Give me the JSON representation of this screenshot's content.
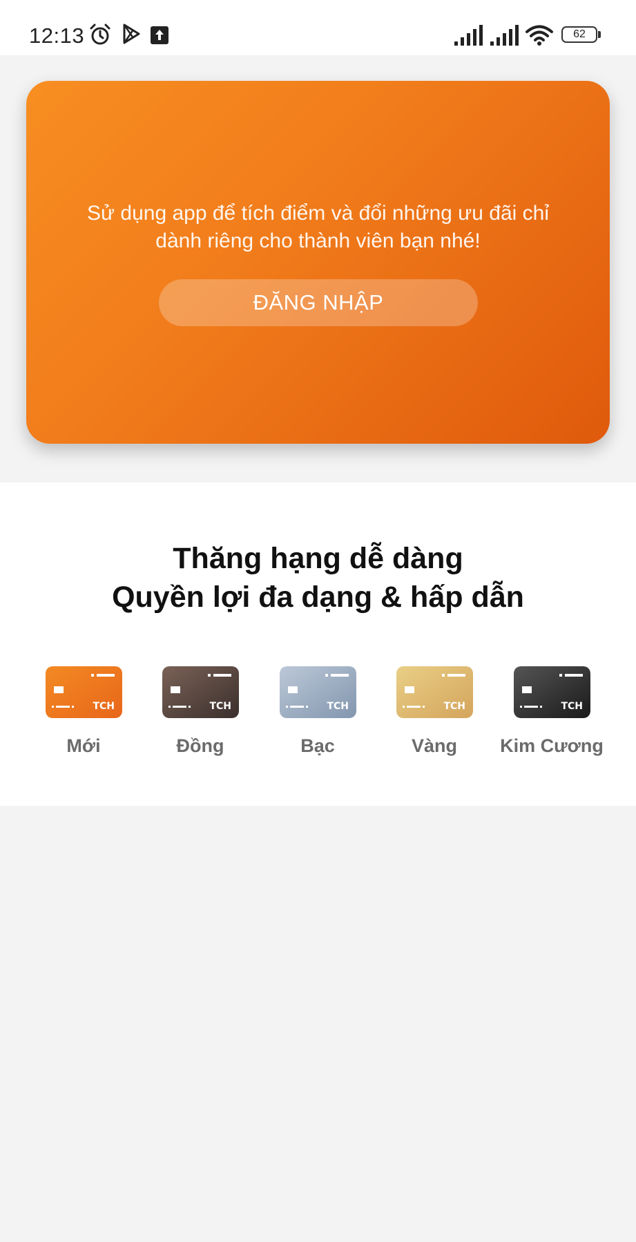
{
  "status_bar": {
    "time": "12:13",
    "battery": "62",
    "icons": [
      "alarm-icon",
      "play-store-icon",
      "upload-icon",
      "signal-icon",
      "signal-icon",
      "wifi-icon",
      "battery-icon"
    ]
  },
  "promo": {
    "line1": "Sử dụng app để tích điểm và đổi những ưu đãi chỉ",
    "line2": "dành riêng cho thành viên bạn nhé!",
    "login_label": "ĐĂNG NHẬP",
    "colors": {
      "start": "#f88e22",
      "end": "#df5a0c"
    }
  },
  "tiers": {
    "title_line1": "Thăng hạng dễ dàng",
    "title_line2": "Quyền lợi đa dạng & hấp dẫn",
    "items": [
      {
        "label": "Mới",
        "card_text": "TCH",
        "colors": [
          "#f38a23",
          "#e8661a"
        ]
      },
      {
        "label": "Đồng",
        "card_text": "TCH",
        "colors": [
          "#7a6257",
          "#3b2f2c"
        ]
      },
      {
        "label": "Bạc",
        "card_text": "TCH",
        "colors": [
          "#bcc8d8",
          "#8296ae"
        ]
      },
      {
        "label": "Vàng",
        "card_text": "TCH",
        "colors": [
          "#e9cf86",
          "#d4a45c"
        ]
      },
      {
        "label": "Kim Cương",
        "card_text": "TCH",
        "colors": [
          "#555555",
          "#1a1a1a"
        ]
      }
    ]
  }
}
